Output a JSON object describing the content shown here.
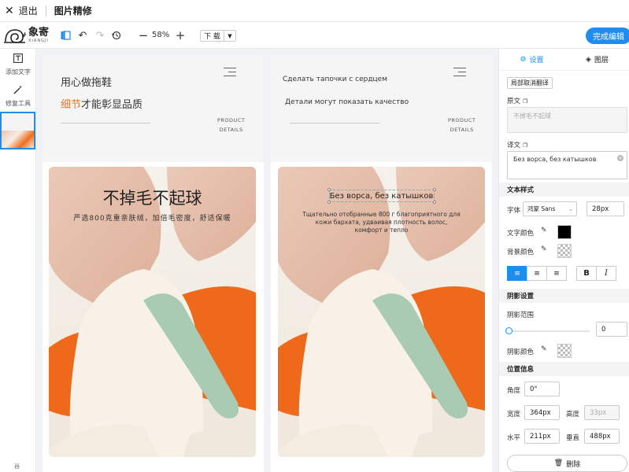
{
  "topbar": {
    "exit_label": "退出",
    "title": "图片精修"
  },
  "logo": {
    "cn": "象寄",
    "en": "XIANGJI"
  },
  "toolbar": {
    "zoom": "58%",
    "download_label": "下 载",
    "finish_label": "完成编辑"
  },
  "leftbar": {
    "add_text": "添加文字",
    "repair_tool": "修复工具",
    "bottom_mark": "器"
  },
  "page1": {
    "headline1": "用心做拖鞋",
    "headline2_accent": "细节",
    "headline2_rest": "才能彰显品质",
    "product_details_1": "PRODUCT",
    "product_details_2": "DETAILS",
    "photo_title": "不掉毛不起球",
    "photo_sub": "严选800克重亲肤绒，加倍毛密度，舒适保暖"
  },
  "page2": {
    "headline1": "Сделать тапочки с сердцем",
    "headline2": "Детали могут показать качество",
    "product_details_1": "PRODUCT",
    "product_details_2": "DETAILS",
    "photo_title": "Без ворса, без катышков",
    "photo_sub": "Тщательно отобранные 800 г благоприятного для кожи бархата, удваивая плотность волос, комфорт и тепло"
  },
  "panel": {
    "tab_settings": "设置",
    "tab_layers": "图层",
    "cancel_translate": "局部取消翻译",
    "original_label": "原文",
    "original_text": "不掉毛不起球",
    "translation_label": "译文",
    "translation_text": "Без ворса, без катышков",
    "text_style_section": "文本样式",
    "font_label": "字体",
    "font_value": "鸿蒙 Sans",
    "font_size": "28px",
    "text_color_label": "文字颜色",
    "bg_color_label": "背景颜色",
    "shadow_section": "阴影设置",
    "shadow_range_label": "阴影范围",
    "shadow_range_value": "0",
    "shadow_color_label": "阴影颜色",
    "position_section": "位置信息",
    "angle_label": "角度",
    "angle_value": "0°",
    "width_label": "宽度",
    "width_value": "364px",
    "height_label": "高度",
    "height_value": "33px",
    "horizontal_label": "水平",
    "horizontal_value": "211px",
    "vertical_label": "垂直",
    "vertical_value": "488px",
    "delete_label": "删除"
  },
  "colors": {
    "accent": "#1f8cf0",
    "headline_accent": "#e0762b",
    "text_color": "#000000"
  },
  "icons": [
    "close-icon",
    "compare-icon",
    "undo-icon",
    "redo-icon",
    "history-icon",
    "zoom-out-icon",
    "zoom-in-icon",
    "chevron-down-icon",
    "text-icon",
    "magic-wand-icon",
    "gear-icon",
    "layers-icon",
    "copy-icon",
    "eyedropper-icon",
    "align-left-icon",
    "align-center-icon",
    "align-right-icon",
    "bold-icon",
    "italic-icon",
    "trash-icon",
    "menu-icon"
  ]
}
